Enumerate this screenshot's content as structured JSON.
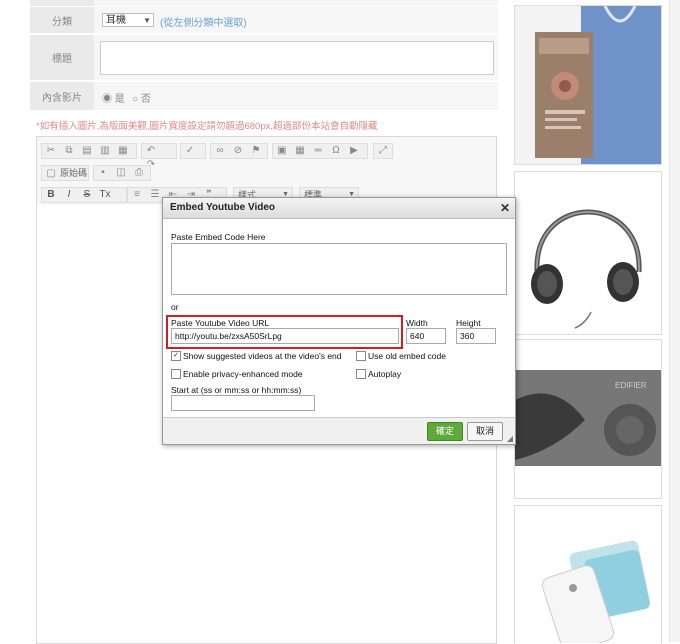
{
  "form": {
    "category_label": "分類",
    "category_value": "耳機",
    "category_hint": "(從左側分類中選取)",
    "title_label": "標題",
    "video_label": "內含影片",
    "video_yes": "是",
    "video_no": "否",
    "note": "*如有插入圖片,為版面美觀,圖片寬度設定請勿超過680px,超過部份本站會自動隱藏"
  },
  "toolbar": {
    "source_label": "原始碼",
    "style_label": "樣式",
    "format_label": "標準"
  },
  "dialog": {
    "title": "Embed Youtube Video",
    "embed_label": "Paste Embed Code Here",
    "or_label": "or",
    "url_label": "Paste Youtube Video URL",
    "url_value": "http://youtu.be/zxsA50SrLpg",
    "width_label": "Width",
    "width_value": "640",
    "height_label": "Height",
    "height_value": "360",
    "opt_suggested": "Show suggested videos at the video's end",
    "opt_old_embed": "Use old embed code",
    "opt_privacy": "Enable privacy-enhanced mode",
    "opt_autoplay": "Autoplay",
    "start_label": "Start at (ss or mm:ss or hh:mm:ss)",
    "start_value": "",
    "ok_label": "確定",
    "cancel_label": "取消"
  },
  "colors": {
    "ok_button": "#5fa93a",
    "highlight_box": "#cc2020",
    "hint_text": "#6aa3d6",
    "note_text": "#e08a8a"
  }
}
